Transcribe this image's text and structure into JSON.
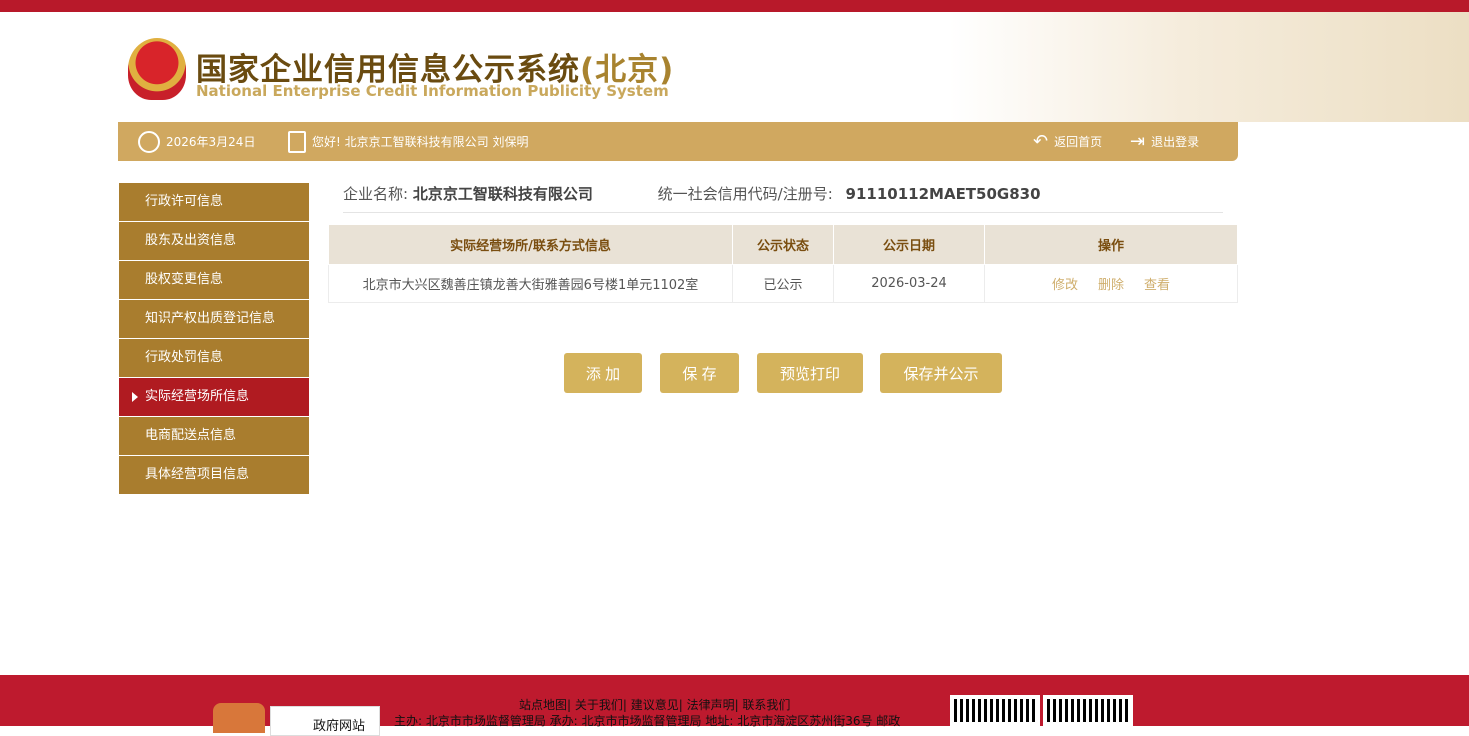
{
  "header": {
    "title_cn": "国家企业信用信息公示系统",
    "title_region": "(北京)",
    "title_en": "National Enterprise Credit Information Publicity System"
  },
  "navbar": {
    "date": "2026年3月24日",
    "greeting": "您好! 北京京工智联科技有限公司  刘保明",
    "home": "返回首页",
    "logout": "退出登录"
  },
  "sidebar": {
    "items": [
      {
        "label": "行政许可信息"
      },
      {
        "label": "股东及出资信息"
      },
      {
        "label": "股权变更信息"
      },
      {
        "label": "知识产权出质登记信息"
      },
      {
        "label": "行政处罚信息"
      },
      {
        "label": "实际经营场所信息"
      },
      {
        "label": "电商配送点信息"
      },
      {
        "label": "具体经营项目信息"
      }
    ]
  },
  "company": {
    "name_label": "企业名称:",
    "name": "北京京工智联科技有限公司",
    "code_label": "统一社会信用代码/注册号:",
    "code": "91110112MAET50G830"
  },
  "table": {
    "headers": [
      "实际经营场所/联系方式信息",
      "公示状态",
      "公示日期",
      "操作"
    ],
    "rows": [
      {
        "address": "北京市大兴区魏善庄镇龙善大街雅善园6号楼1单元1102室",
        "status": "已公示",
        "date": "2026-03-24",
        "actions": [
          "修改",
          "删除",
          "查看"
        ]
      }
    ]
  },
  "buttons": {
    "add": "添 加",
    "save": "保 存",
    "preview": "预览打印",
    "save_publish": "保存并公示"
  },
  "footer": {
    "links": "站点地图| 关于我们| 建议意见| 法律声明| 联系我们",
    "org": "主办: 北京市市场监督管理局 承办: 北京市市场监督管理局 地址: 北京市海淀区苏州街36号 邮政",
    "gov_label": "政府网站"
  },
  "colors": {
    "red": "#b8192a",
    "gold": "#d0a860",
    "brown": "#a97d2e",
    "active": "#b01b21"
  }
}
